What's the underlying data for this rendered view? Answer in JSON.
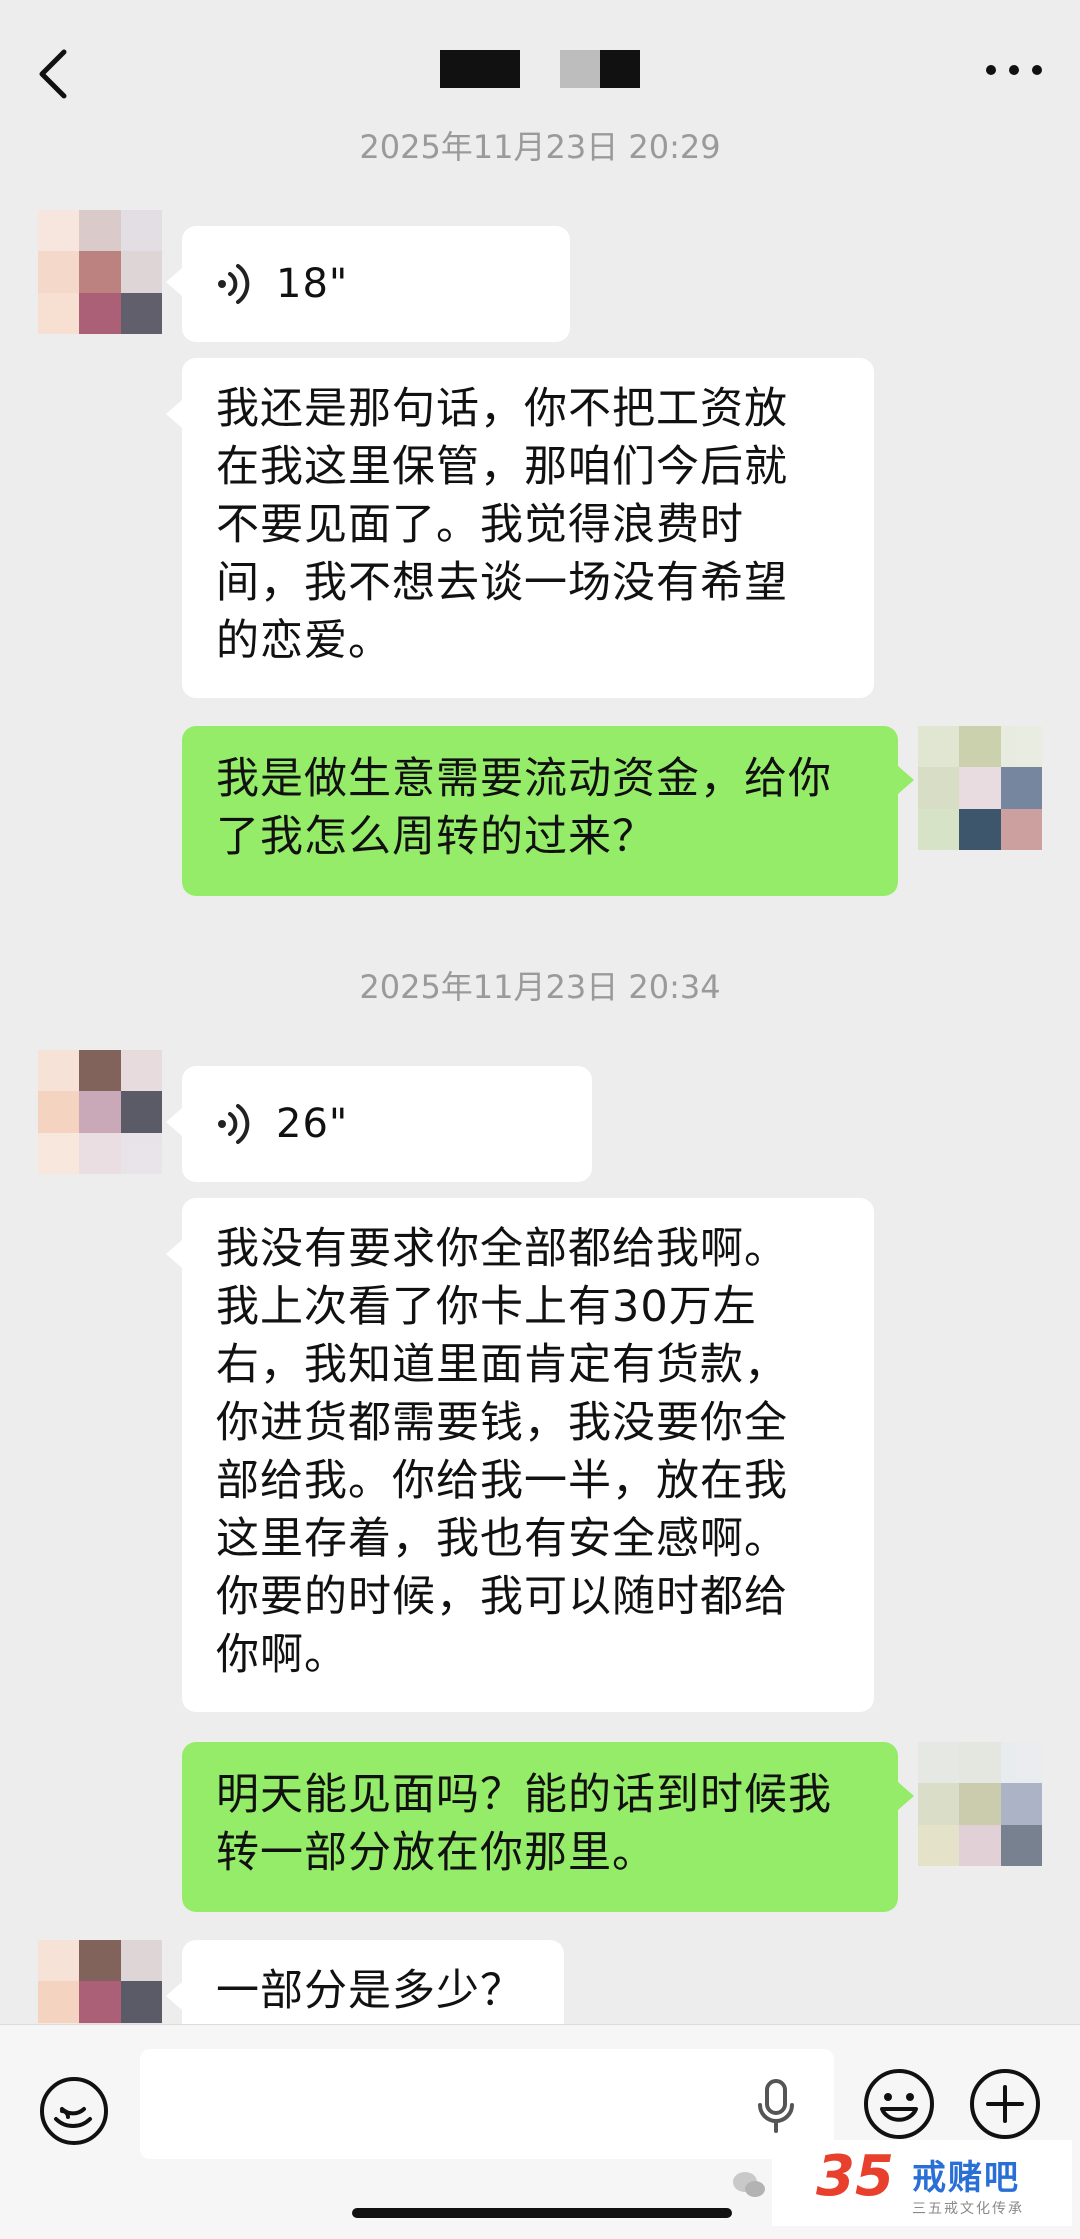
{
  "header": {
    "title": ""
  },
  "messages": {
    "ts1": "2025年11月23日 20:29",
    "ts2": "2025年11月23日 20:34",
    "voice1": "18\"",
    "text1": "我还是那句话，你不把工资放\n在我这里保管，那咱们今后就\n不要见面了。我觉得浪费时\n间，我不想去谈一场没有希望\n的恋爱。",
    "text2": "我是做生意需要流动资金，给你\n了我怎么周转的过来？",
    "voice2": "26\"",
    "text3": "我没有要求你全部都给我啊。\n我上次看了你卡上有30万左\n右，我知道里面肯定有货款，\n你进货都需要钱，我没要你全\n部给我。你给我一半，放在我\n这里存着，我也有安全感啊。\n你要的时候，我可以随时都给\n你啊。",
    "text4": "明天能见面吗？能的话到时候我\n转一部分放在你那里。",
    "text5": "一部分是多少？"
  },
  "input": {
    "placeholder": ""
  },
  "watermark": {
    "number": "35",
    "name": "戒赌吧",
    "subtitle": "三五戒文化传承"
  },
  "colors": {
    "background": "#ededed",
    "sent_bubble": "#95ec69",
    "received_bubble": "#ffffff"
  },
  "icons": [
    "back-icon",
    "more-icon",
    "voice-message-icon",
    "voice-toggle-icon",
    "mic-icon",
    "emoji-icon",
    "plus-icon"
  ]
}
